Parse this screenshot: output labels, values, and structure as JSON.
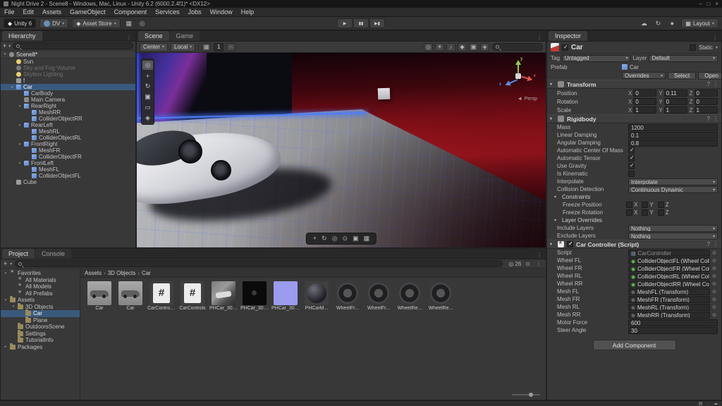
{
  "window": {
    "title": "Night Drive 2 - Scene8 - Windows, Mac, Linux - Unity 6.2 (6000.2.4f1)* <DX12>",
    "controls": {
      "minimize": "–",
      "maximize": "□",
      "close": "×"
    }
  },
  "icons": {
    "kebab": "⋮",
    "help": "?",
    "plus": "+",
    "cloud": "☁",
    "refresh": "↻",
    "bell": "●",
    "eye": "◎",
    "persp_arrow": "◄",
    "picker": "⊙",
    "grid": "▦",
    "target": "◎",
    "play": "▶",
    "pause": "▮▮",
    "step": "▶▮",
    "snap_grid": "▦",
    "magnet": "∩",
    "store": "◆"
  },
  "menu": {
    "items": [
      "File",
      "Edit",
      "Assets",
      "GameObject",
      "Component",
      "Services",
      "Jobs",
      "Window",
      "Help"
    ]
  },
  "toolbar": {
    "brand": "Unity 6",
    "account": "DV",
    "asset_store": "Asset Store",
    "layout": "Layout"
  },
  "hierarchy": {
    "tab": "Hierarchy",
    "scene_name": "Scene8*",
    "items": [
      {
        "label": "Sun",
        "indent": "1",
        "kind": "light",
        "arrow": ""
      },
      {
        "label": "Sky and Fog Volume",
        "indent": "1",
        "kind": "volume",
        "dim": "true"
      },
      {
        "label": "Skybox Lighting",
        "indent": "1",
        "kind": "light",
        "dim": "true"
      },
      {
        "label": "f",
        "indent": "1",
        "kind": "go"
      },
      {
        "label": "Car",
        "indent": "1",
        "kind": "prefab",
        "arrow": "▾",
        "selected": "true"
      },
      {
        "label": "CarBody",
        "indent": "2",
        "kind": "prefab"
      },
      {
        "label": "Main Camera",
        "indent": "2",
        "kind": "camera"
      },
      {
        "label": "RearRight",
        "indent": "2",
        "kind": "prefab",
        "arrow": "▾"
      },
      {
        "label": "MeshRR",
        "indent": "3",
        "kind": "prefab"
      },
      {
        "label": "ColliderObjectRR",
        "indent": "3",
        "kind": "prefab"
      },
      {
        "label": "RearLeft",
        "indent": "2",
        "kind": "prefab",
        "arrow": "▾"
      },
      {
        "label": "MeshRL",
        "indent": "3",
        "kind": "prefab"
      },
      {
        "label": "ColliderObjectRL",
        "indent": "3",
        "kind": "prefab"
      },
      {
        "label": "FrontRight",
        "indent": "2",
        "kind": "prefab",
        "arrow": "▾"
      },
      {
        "label": "MeshFR",
        "indent": "3",
        "kind": "prefab"
      },
      {
        "label": "ColliderObjectFR",
        "indent": "3",
        "kind": "prefab"
      },
      {
        "label": "FrontLeft",
        "indent": "2",
        "kind": "prefab",
        "arrow": "▾"
      },
      {
        "label": "MeshFL",
        "indent": "3",
        "kind": "prefab"
      },
      {
        "label": "ColliderObjectFL",
        "indent": "3",
        "kind": "prefab"
      },
      {
        "label": "Cube",
        "indent": "1",
        "kind": "go"
      }
    ]
  },
  "scene": {
    "tabs": {
      "scene": "Scene",
      "game": "Game"
    },
    "toolbar": {
      "pivot": "Center",
      "space": "Local",
      "snap": "1"
    },
    "tools": [
      {
        "name": "view-tool",
        "glyph": "◎"
      },
      {
        "name": "move-tool",
        "glyph": "+"
      },
      {
        "name": "rotate-tool",
        "glyph": "↻"
      },
      {
        "name": "scale-tool",
        "glyph": "▣"
      },
      {
        "name": "rect-tool",
        "glyph": "▭"
      },
      {
        "name": "transform-tool",
        "glyph": "◈"
      }
    ],
    "right_icons": [
      {
        "name": "visibility-icon",
        "glyph": "◎"
      },
      {
        "name": "lighting-icon",
        "glyph": "☀"
      },
      {
        "name": "audio-icon",
        "glyph": "♪"
      },
      {
        "name": "effects-icon",
        "glyph": "◆"
      },
      {
        "name": "camera-preview-icon",
        "glyph": "▣"
      },
      {
        "name": "gizmos-icon",
        "glyph": "◈"
      }
    ],
    "cam_tools": [
      {
        "name": "pan-tool-icon",
        "glyph": "+"
      },
      {
        "name": "orbit-tool-icon",
        "glyph": "↻"
      },
      {
        "name": "eye-tool-icon",
        "glyph": "◎"
      },
      {
        "name": "zoom-tool-icon",
        "glyph": "⊙"
      },
      {
        "name": "frame-tool-icon",
        "glyph": "▣"
      },
      {
        "name": "grid-tool-icon",
        "glyph": "▦"
      }
    ],
    "gizmo": {
      "x": "x",
      "y": "y",
      "z": "z",
      "label": "Persp"
    }
  },
  "inspector": {
    "tab": "Inspector",
    "header": {
      "name": "Car",
      "static_label": "Static"
    },
    "tag_row": {
      "tag_label": "Tag",
      "tag_value": "Untagged",
      "layer_label": "Layer",
      "layer_value": "Default"
    },
    "prefab_row": {
      "label": "Prefab",
      "value": "Car",
      "overrides": "Overrides",
      "select": "Select",
      "open": "Open"
    },
    "axis": {
      "x": "X",
      "y": "Y",
      "z": "Z"
    },
    "transform": {
      "title": "Transform",
      "rows": [
        {
          "label": "Position",
          "x": "0",
          "y": "0.11",
          "z": "0"
        },
        {
          "label": "Rotation",
          "x": "0",
          "y": "0",
          "z": "0"
        },
        {
          "label": "Scale",
          "x": "1",
          "y": "1",
          "z": "1"
        }
      ]
    },
    "rigidbody": {
      "title": "Rigidbody",
      "rows": [
        {
          "label": "Mass",
          "value": "1200",
          "type": "field"
        },
        {
          "label": "Linear Damping",
          "value": "0.1",
          "type": "field"
        },
        {
          "label": "Angular Damping",
          "value": "0.8",
          "type": "field"
        },
        {
          "label": "Automatic Center Of Mass",
          "type": "check",
          "checked": "true"
        },
        {
          "label": "Automatic Tensor",
          "type": "check",
          "checked": "true"
        },
        {
          "label": "Use Gravity",
          "type": "check",
          "checked": "true"
        },
        {
          "label": "Is Kinematic",
          "type": "check",
          "checked": "false"
        },
        {
          "label": "Interpolate",
          "value": "Interpolate",
          "type": "dropdown"
        },
        {
          "label": "Collision Detection",
          "value": "Continuous Dynamic",
          "type": "dropdown"
        }
      ],
      "constraints": {
        "title": "Constraints",
        "rows": [
          {
            "label": "Freeze Position"
          },
          {
            "label": "Freeze Rotation"
          }
        ]
      },
      "layer_overrides": {
        "title": "Layer Overrides",
        "rows": [
          {
            "label": "Include Layers",
            "value": "Nothing",
            "type": "dropdown"
          },
          {
            "label": "Exclude Layers",
            "value": "Nothing",
            "type": "dropdown"
          }
        ]
      }
    },
    "car_controller": {
      "title": "Car Controller (Script)",
      "rows": [
        {
          "label": "Script",
          "value": "CarController",
          "type": "object",
          "icon": "script",
          "dim": "true"
        },
        {
          "label": "Wheel FL",
          "value": "ColliderObjectFL (Wheel Collider)",
          "type": "object",
          "icon": "collider"
        },
        {
          "label": "Wheel FR",
          "value": "ColliderObjectFR (Wheel Collider)",
          "type": "object",
          "icon": "collider"
        },
        {
          "label": "Wheel RL",
          "value": "ColliderObjectRL (Wheel Collider)",
          "type": "object",
          "icon": "collider"
        },
        {
          "label": "Wheel RR",
          "value": "ColliderObjectRR (Wheel Collider)",
          "type": "object",
          "icon": "collider"
        },
        {
          "label": "Mesh FL",
          "value": "MeshFL (Transform)",
          "type": "object",
          "icon": "transform"
        },
        {
          "label": "Mesh FR",
          "value": "MeshFR (Transform)",
          "type": "object",
          "icon": "transform"
        },
        {
          "label": "Mesh RL",
          "value": "MeshRL (Transform)",
          "type": "object",
          "icon": "transform"
        },
        {
          "label": "Mesh RR",
          "value": "MeshRR (Transform)",
          "type": "object",
          "icon": "transform"
        },
        {
          "label": "Motor Force",
          "value": "600",
          "type": "field"
        },
        {
          "label": "Steer Angle",
          "value": "30",
          "type": "field"
        }
      ]
    },
    "add_component": "Add Component"
  },
  "project": {
    "tabs": {
      "project": "Project",
      "console": "Console"
    },
    "count_badge": "26",
    "tree": [
      {
        "label": "Favorites",
        "indent": "0",
        "kind": "star",
        "arrow": "▾"
      },
      {
        "label": "All Materials",
        "indent": "1",
        "kind": "fav"
      },
      {
        "label": "All Models",
        "indent": "1",
        "kind": "fav"
      },
      {
        "label": "All Prefabs",
        "indent": "1",
        "kind": "fav"
      },
      {
        "label": "Assets",
        "indent": "0",
        "kind": "folder",
        "arrow": "▾"
      },
      {
        "label": "3D Objects",
        "indent": "1",
        "kind": "folder",
        "arrow": "▾"
      },
      {
        "label": "Car",
        "indent": "2",
        "kind": "folder",
        "selected": "true"
      },
      {
        "label": "Plane",
        "indent": "2",
        "kind": "folder"
      },
      {
        "label": "OutdoorsScene",
        "indent": "1",
        "kind": "folder"
      },
      {
        "label": "Settings",
        "indent": "1",
        "kind": "folder"
      },
      {
        "label": "TutorialInfo",
        "indent": "1",
        "kind": "folder"
      },
      {
        "label": "Packages",
        "indent": "0",
        "kind": "folder",
        "arrow": "▸"
      }
    ],
    "breadcrumb": [
      "Assets",
      "3D Objects",
      "Car"
    ],
    "thumbnails": [
      {
        "label": "Car",
        "kind": "car"
      },
      {
        "label": "Car",
        "kind": "car"
      },
      {
        "label": "CarController",
        "kind": "script"
      },
      {
        "label": "CarControls",
        "kind": "script"
      },
      {
        "label": "PHCar_3001...",
        "kind": "img-car"
      },
      {
        "label": "PHCar_3001...",
        "kind": "img-black"
      },
      {
        "label": "PHCar_3001...",
        "kind": "img-purple"
      },
      {
        "label": "PHCarM...",
        "kind": "material"
      },
      {
        "label": "WheelFr...",
        "kind": "wheel"
      },
      {
        "label": "WheelFr...",
        "kind": "wheel"
      },
      {
        "label": "WheelRe...",
        "kind": "wheel"
      },
      {
        "label": "WheelRe...",
        "kind": "wheel"
      }
    ]
  },
  "status": {
    "icons": [
      {
        "name": "console-status-icon",
        "glyph": "▤"
      },
      {
        "name": "activity-icon",
        "glyph": "◌"
      },
      {
        "name": "cloud-status-icon",
        "glyph": "☁"
      }
    ]
  }
}
